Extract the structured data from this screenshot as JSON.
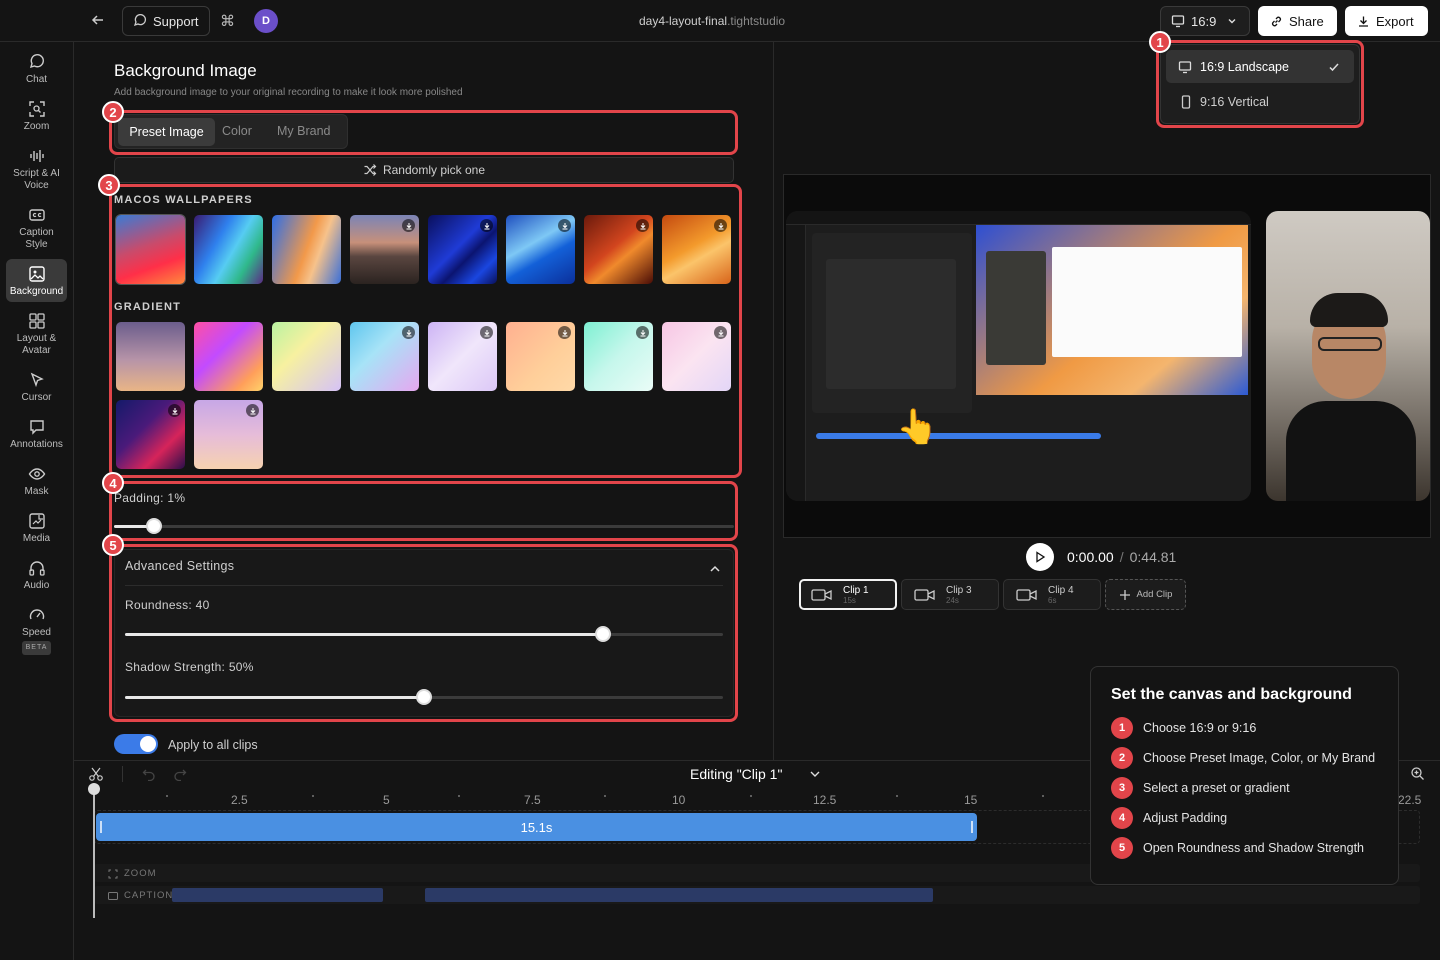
{
  "topbar": {
    "support_label": "Support",
    "avatar_initial": "D",
    "filename": "day4-layout-final",
    "file_ext": ".tightstudio",
    "ratio_label": "16:9",
    "share_label": "Share",
    "export_label": "Export"
  },
  "ratio_menu": {
    "options": [
      {
        "label": "16:9 Landscape",
        "selected": true
      },
      {
        "label": "9:16 Vertical",
        "selected": false
      }
    ]
  },
  "sidebar": {
    "items": [
      {
        "label": "Chat",
        "icon": "chat-bubble-icon"
      },
      {
        "label": "Zoom",
        "icon": "zoom-frame-icon"
      },
      {
        "label": "Script & AI Voice",
        "icon": "waveform-icon"
      },
      {
        "label": "Caption Style",
        "icon": "captions-icon"
      },
      {
        "label": "Background",
        "icon": "image-icon",
        "active": true
      },
      {
        "label": "Layout & Avatar",
        "icon": "layout-grid-icon"
      },
      {
        "label": "Cursor",
        "icon": "cursor-icon"
      },
      {
        "label": "Annotations",
        "icon": "annotation-icon"
      },
      {
        "label": "Mask",
        "icon": "eye-icon"
      },
      {
        "label": "Media",
        "icon": "media-icon"
      },
      {
        "label": "Audio",
        "icon": "headphones-icon"
      },
      {
        "label": "Speed",
        "icon": "speedometer-icon",
        "badge": "BETA"
      }
    ]
  },
  "background": {
    "title": "Background Image",
    "subtitle": "Add background image to your original recording to make it look more polished",
    "tabs": [
      "Preset Image",
      "Color",
      "My Brand"
    ],
    "active_tab": "Preset Image",
    "random_label": "Randomly pick one",
    "macos_label": "MACOS WALLPAPERS",
    "gradient_label": "GRADIENT",
    "padding_label": "Padding: 1%",
    "padding_value": 1,
    "advanced_label": "Advanced Settings",
    "roundness_label": "Roundness: 40",
    "roundness_value": 40,
    "shadow_label": "Shadow Strength: 50%",
    "shadow_value": 50,
    "apply_all_label": "Apply to all clips",
    "apply_all": true
  },
  "player": {
    "current_time": "0:00.00",
    "separator": "/",
    "total_time": "0:44.81"
  },
  "clips": [
    {
      "name": "Clip 1",
      "duration": "15s",
      "active": true
    },
    {
      "name": "Clip 3",
      "duration": "24s"
    },
    {
      "name": "Clip 4",
      "duration": "6s"
    }
  ],
  "add_clip_label": "Add Clip",
  "timeline": {
    "editing_label": "Editing \"Clip 1\"",
    "ticks": [
      "2.5",
      "5",
      "7.5",
      "10",
      "12.5",
      "15",
      "22.5"
    ],
    "clip_duration_label": "15.1s",
    "zoom_track_label": "ZOOM",
    "caption_track_label": "CAPTION"
  },
  "guide": {
    "title": "Set the canvas and background",
    "steps": [
      {
        "n": "1",
        "text": "Choose 16:9 or 9:16"
      },
      {
        "n": "2",
        "text": "Choose Preset Image, Color, or My Brand"
      },
      {
        "n": "3",
        "text": "Select a preset or gradient"
      },
      {
        "n": "4",
        "text": "Adjust Padding"
      },
      {
        "n": "5",
        "text": "Open Roundness and Shadow Strength"
      }
    ]
  },
  "callouts": [
    "1",
    "2",
    "3",
    "4",
    "5"
  ],
  "colors": {
    "accent": "#4a90e2",
    "highlight": "#e2454a",
    "background": "#141414"
  }
}
